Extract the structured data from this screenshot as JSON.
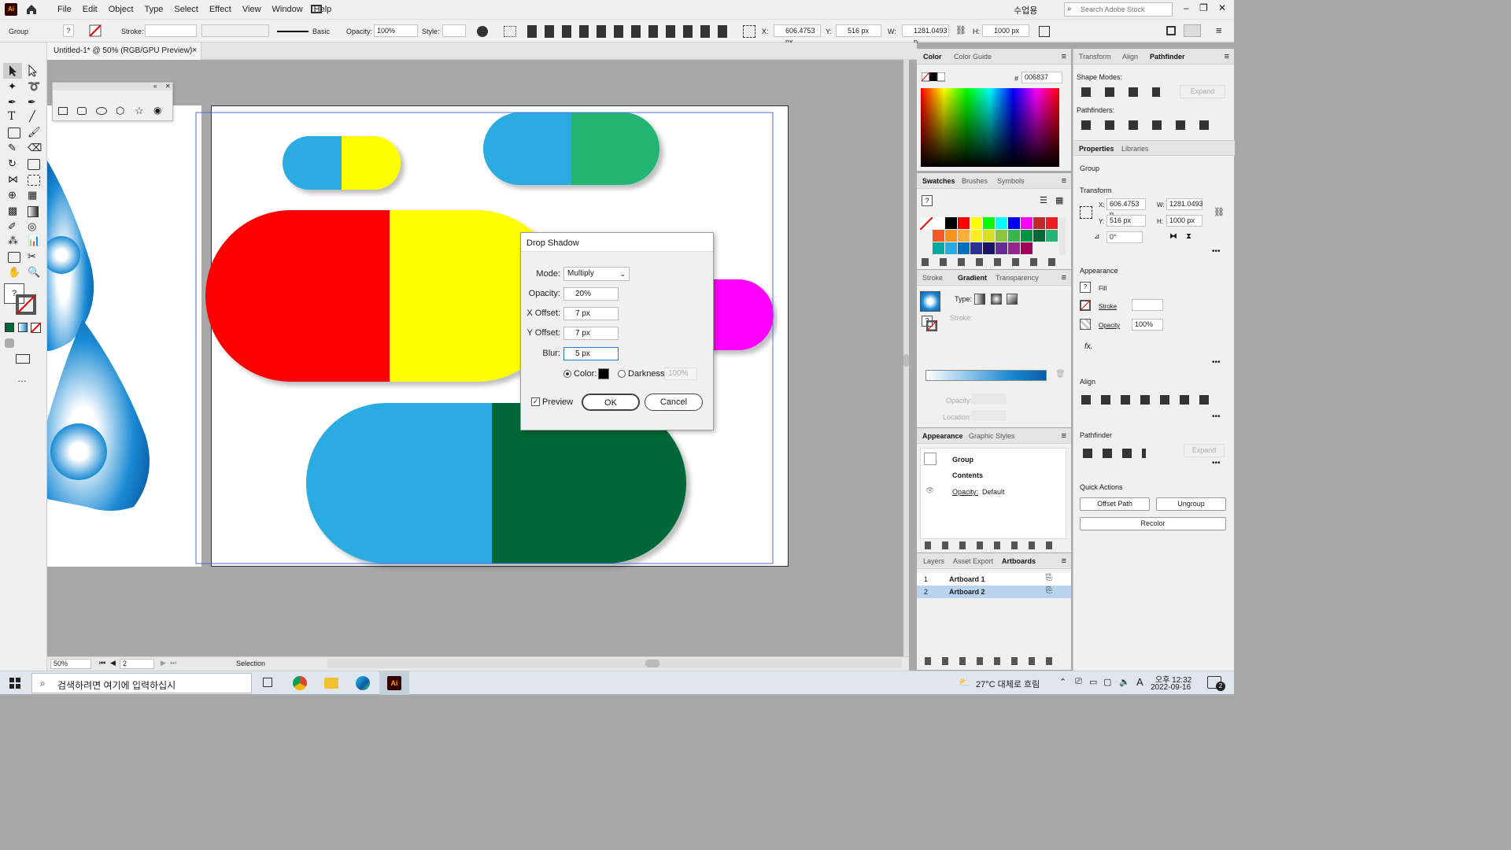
{
  "menu": {
    "items": [
      "File",
      "Edit",
      "Object",
      "Type",
      "Select",
      "Effect",
      "View",
      "Window",
      "Help"
    ],
    "workspace": "수업용",
    "search_placeholder": "Search Adobe Stock"
  },
  "control": {
    "selection": "Group",
    "fill_q": "?",
    "stroke_label": "Stroke:",
    "basic": "Basic",
    "opacity_label": "Opacity:",
    "opacity": "100%",
    "style_label": "Style:",
    "x_label": "X:",
    "x": "606.4753 px",
    "y_label": "Y:",
    "y": "516 px",
    "w_label": "W:",
    "w": "1281.0493 p",
    "h_label": "H:",
    "h": "1000 px"
  },
  "doc": {
    "tab_title": "Untitled-1* @ 50% (RGB/GPU Preview)",
    "close": "×"
  },
  "status": {
    "zoom": "50%",
    "artboard": "2",
    "tool": "Selection"
  },
  "dialog": {
    "title": "Drop Shadow",
    "mode_label": "Mode:",
    "mode": "Multiply",
    "opacity_label": "Opacity:",
    "opacity": "20%",
    "xoff_label": "X Offset:",
    "xoff": "7 px",
    "yoff_label": "Y Offset:",
    "yoff": "7 px",
    "blur_label": "Blur:",
    "blur": "5 px",
    "color_label": "Color:",
    "darkness_label": "Darkness:",
    "darkness": "100%",
    "preview_label": "Preview",
    "ok": "OK",
    "cancel": "Cancel"
  },
  "color_panel": {
    "tabs": [
      "Color",
      "Color Guide"
    ],
    "hex_label": "#",
    "hex": "006837"
  },
  "swatches_panel": {
    "tabs": [
      "Swatches",
      "Brushes",
      "Symbols"
    ],
    "colors": [
      "#ffffff",
      "#000000",
      "#ff0000",
      "#ffff00",
      "#00ff00",
      "#00ffff",
      "#0000ff",
      "#ff00ff",
      "#c1272d",
      "#ed1c24",
      "#f15a24",
      "#f7931e",
      "#fbb03b",
      "#fcee21",
      "#d9e021",
      "#8cc63f",
      "#39b54a",
      "#009245",
      "#006837",
      "#22b573",
      "#00a99d",
      "#29abe2",
      "#0071bc",
      "#2e3192",
      "#1b1464",
      "#662d91",
      "#93278f",
      "#9e005d"
    ]
  },
  "gradient_panel": {
    "tabs": [
      "Stroke",
      "Gradient",
      "Transparency"
    ],
    "type_label": "Type:",
    "stroke_label": "Stroke:",
    "opacity_label": "Opacity:",
    "location_label": "Location:"
  },
  "appearance_panel": {
    "tabs": [
      "Appearance",
      "Graphic Styles"
    ],
    "group": "Group",
    "contents": "Contents",
    "opacity_label": "Opacity:",
    "opacity_value": "Default"
  },
  "layers_panel": {
    "tabs": [
      "Layers",
      "Asset Export",
      "Artboards"
    ],
    "rows": [
      {
        "num": "1",
        "name": "Artboard 1"
      },
      {
        "num": "2",
        "name": "Artboard 2"
      }
    ]
  },
  "right_panel": {
    "tabs": [
      "Transform",
      "Align",
      "Pathfinder"
    ],
    "shape_modes": "Shape Modes:",
    "pathfinders": "Pathfinders:",
    "expand": "Expand",
    "prop_tabs": [
      "Properties",
      "Libraries"
    ],
    "group": "Group",
    "transform": "Transform",
    "x_label": "X:",
    "x": "606.4753 p",
    "w_label": "W:",
    "w": "1281.0493",
    "y_label": "Y:",
    "y": "516 px",
    "h_label": "H:",
    "h": "1000 px",
    "angle": "0°",
    "appearance": "Appearance",
    "fill": "Fill",
    "stroke": "Stroke",
    "opacity_label": "Opacity",
    "opacity": "100%",
    "fx": "fx.",
    "align": "Align",
    "pathfinder": "Pathfinder",
    "expand2": "Expand",
    "quick_actions": "Quick Actions",
    "offset_path": "Offset Path",
    "ungroup": "Ungroup",
    "recolor": "Recolor"
  },
  "taskbar": {
    "search": "검색하려면 여기에 입력하십시",
    "weather": "27°C 대체로 흐림",
    "time": "오후 12:32",
    "date": "2022-09-16",
    "ime": "A",
    "notif": "2"
  }
}
